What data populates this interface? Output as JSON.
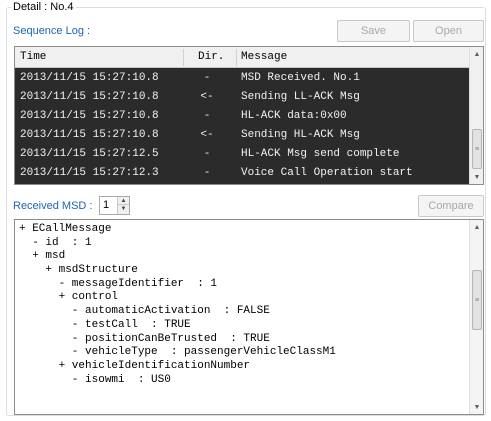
{
  "group_title": "Detail : No.4",
  "sequence_label": "Sequence Log :",
  "buttons": {
    "save": "Save",
    "open": "Open",
    "compare": "Compare"
  },
  "log": {
    "columns": [
      "Time",
      "Dir.",
      "Message"
    ],
    "rows": [
      {
        "time": "2013/11/15 15:27:10.8",
        "dir": "-",
        "message": "MSD Received. No.1"
      },
      {
        "time": "2013/11/15 15:27:10.8",
        "dir": "<-",
        "message": "Sending LL-ACK Msg"
      },
      {
        "time": "2013/11/15 15:27:10.8",
        "dir": "-",
        "message": "HL-ACK data:0x00"
      },
      {
        "time": "2013/11/15 15:27:10.8",
        "dir": "<-",
        "message": "Sending HL-ACK Msg"
      },
      {
        "time": "2013/11/15 15:27:12.5",
        "dir": "-",
        "message": "HL-ACK Msg send complete"
      },
      {
        "time": "2013/11/15 15:27:12.3",
        "dir": "-",
        "message": "Voice Call Operation start"
      }
    ]
  },
  "received_msd": {
    "label": "Received MSD :",
    "value": "1"
  },
  "tree_lines": [
    "+ ECallMessage",
    "  - id  : 1",
    "  + msd",
    "    + msdStructure",
    "      - messageIdentifier  : 1",
    "      + control",
    "        - automaticActivation  : FALSE",
    "        - testCall  : TRUE",
    "        - positionCanBeTrusted  : TRUE",
    "        - vehicleType  : passengerVehicleClassM1",
    "      + vehicleIdentificationNumber",
    "        - isowmi  : US0"
  ],
  "icons": {
    "scroll_up": "chevron-up-icon",
    "scroll_down": "chevron-down-icon",
    "scroll_grip": "grip-icon"
  }
}
